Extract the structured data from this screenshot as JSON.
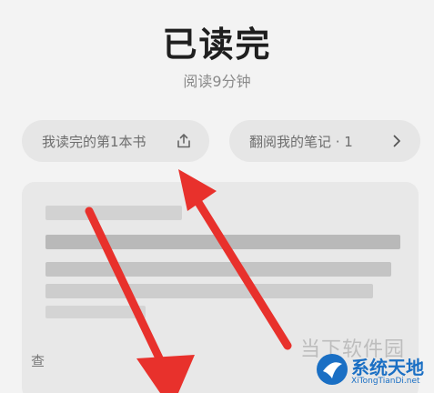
{
  "header": {
    "title": "已读完",
    "subtitle": "阅读9分钟"
  },
  "actions": {
    "share_label": "我读完的第1本书",
    "notes_label": "翻阅我的笔记 · 1"
  },
  "card": {
    "footer_text": "查"
  },
  "watermark": {
    "site_text": "当下软件园",
    "logo_name": "系统天地",
    "logo_url": "XiTongTianDi.net"
  },
  "colors": {
    "arrow": "#e8312c",
    "background": "#f3f3f3",
    "pill": "#e6e6e6",
    "logo_blue": "#1a6fc4"
  },
  "icons": {
    "share": "share-icon",
    "chevron": "chevron-right-icon"
  }
}
